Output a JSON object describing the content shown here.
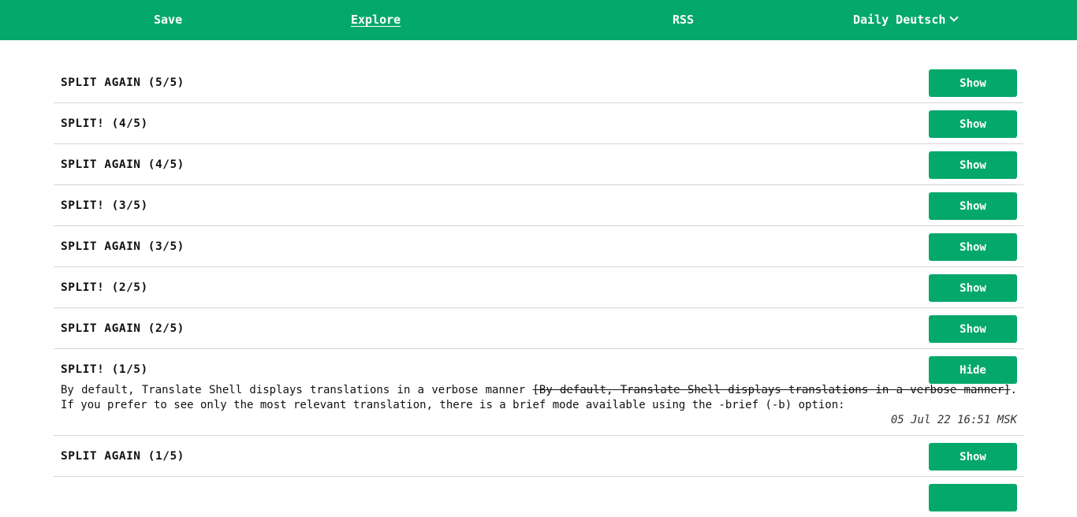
{
  "nav": {
    "save": "Save",
    "explore": "Explore",
    "rss": "RSS",
    "daily": "Daily Deutsch",
    "accent_color": "#05a86b"
  },
  "rows": [
    {
      "title": "SPLIT AGAIN (5/5)",
      "button": "Show"
    },
    {
      "title": "SPLIT! (4/5)",
      "button": "Show"
    },
    {
      "title": "SPLIT AGAIN (4/5)",
      "button": "Show"
    },
    {
      "title": "SPLIT! (3/5)",
      "button": "Show"
    },
    {
      "title": "SPLIT AGAIN (3/5)",
      "button": "Show"
    },
    {
      "title": "SPLIT! (2/5)",
      "button": "Show"
    },
    {
      "title": "SPLIT AGAIN (2/5)",
      "button": "Show"
    },
    {
      "title": "SPLIT! (1/5)",
      "button": "Hide",
      "expanded": true,
      "text_before": "By default, Translate Shell displays translations in a verbose manner ",
      "text_struck": "[By default, Translate Shell displays translations in a verbose manner]",
      "text_after": ". If you prefer to see only the most relevant translation, there is a brief mode available using the -brief (-b) option:",
      "timestamp": "05 Jul 22 16:51 MSK"
    },
    {
      "title": "SPLIT AGAIN (1/5)",
      "button": "Show"
    },
    {
      "title": "",
      "button": ""
    }
  ]
}
